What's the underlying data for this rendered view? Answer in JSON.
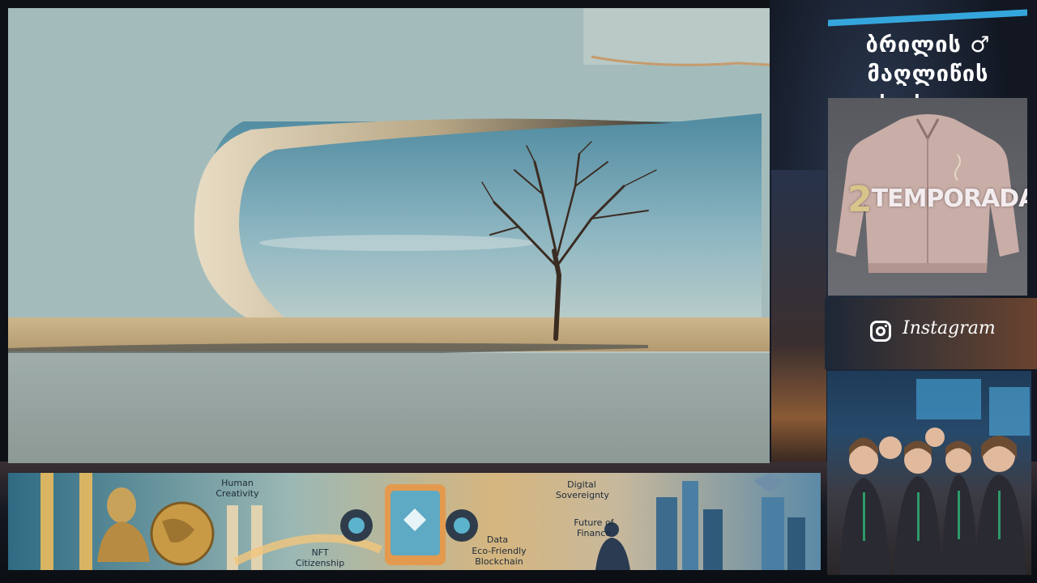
{
  "right_panel": {
    "shop_title_line1": "ბრილის ♂ მაღლიწის",
    "shop_title_line2": "სახლი",
    "promo": {
      "number": "2",
      "word": "TEMPORADA!"
    },
    "instagram_label": "Instagram"
  },
  "banner": {
    "labels": {
      "human_creativity": "Human Creativity",
      "nft_citizenship": "NFT Citizenship",
      "digital_sovereignty": "Digital Sovereignty",
      "future_of_finance": "Future of Finance",
      "data": "Data",
      "eco_friendly_blockchain": "Eco-Friendly Blockchain"
    }
  },
  "colors": {
    "accent_stripe": "#35a6dc",
    "sky": "#9fb9b9",
    "sand": "#c8b48c"
  }
}
